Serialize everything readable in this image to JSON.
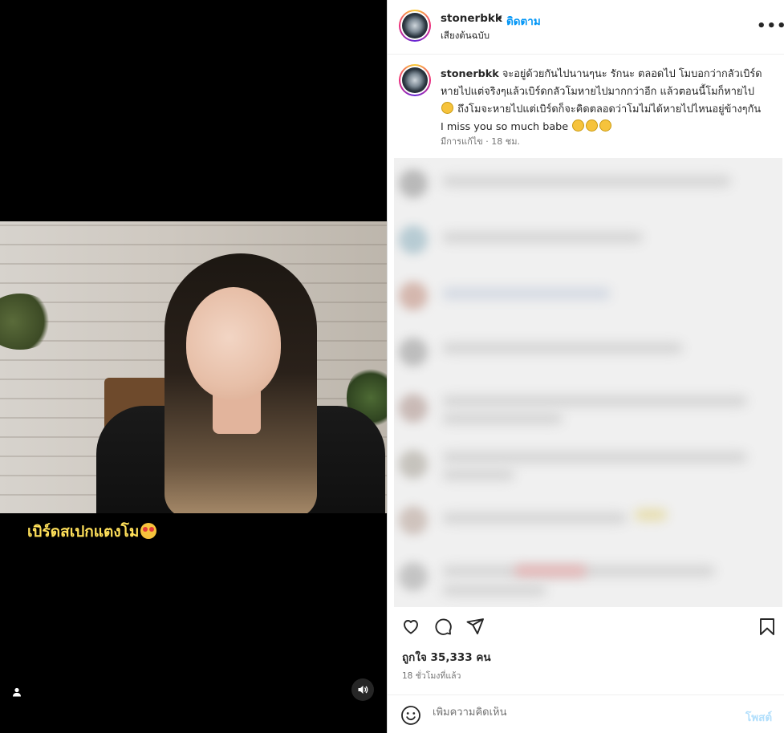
{
  "media": {
    "subtitle_text": "เบิร์ดสเปกแตงโม"
  },
  "header": {
    "username": "stonerbkk",
    "separator": "•",
    "follow_label": "ติดตาม",
    "audio_label": "เสียงต้นฉบับ",
    "more_label": "•••"
  },
  "caption": {
    "username": "stonerbkk",
    "text_1": " จะอยู่ด้วยกันไปนานๆนะ รักนะ ตลอดไป โมบอกว่ากลัวเบิร์ดหายไปแต่จริงๆแล้วเบิร์ดกลัวโมหายไปมากกว่าอีก แล้วตอนนี้โมก็หายไป ",
    "text_2": " ถึงโมจะหายไปแต่เบิร์ดก็จะคิดตลอดว่าโมไม่ได้หายไปไหนอยู่ข้างๆกัน I miss you so much babe ",
    "meta": "มีการแก้ไข · 18 ชม."
  },
  "stats": {
    "likes": "ถูกใจ 35,333 คน",
    "time_ago": "18 ชั่วโมงที่แล้ว"
  },
  "comment_box": {
    "placeholder": "เพิ่มความคิดเห็น",
    "post_label": "โพสต์"
  },
  "colors": {
    "accent": "#0095f6",
    "post_disabled": "#b2dffc",
    "subtitle": "#ffe05a"
  },
  "icons": [
    "user-tag-icon",
    "speaker-icon",
    "heart-icon",
    "comment-icon",
    "share-icon",
    "bookmark-icon",
    "smile-icon",
    "more-icon"
  ]
}
